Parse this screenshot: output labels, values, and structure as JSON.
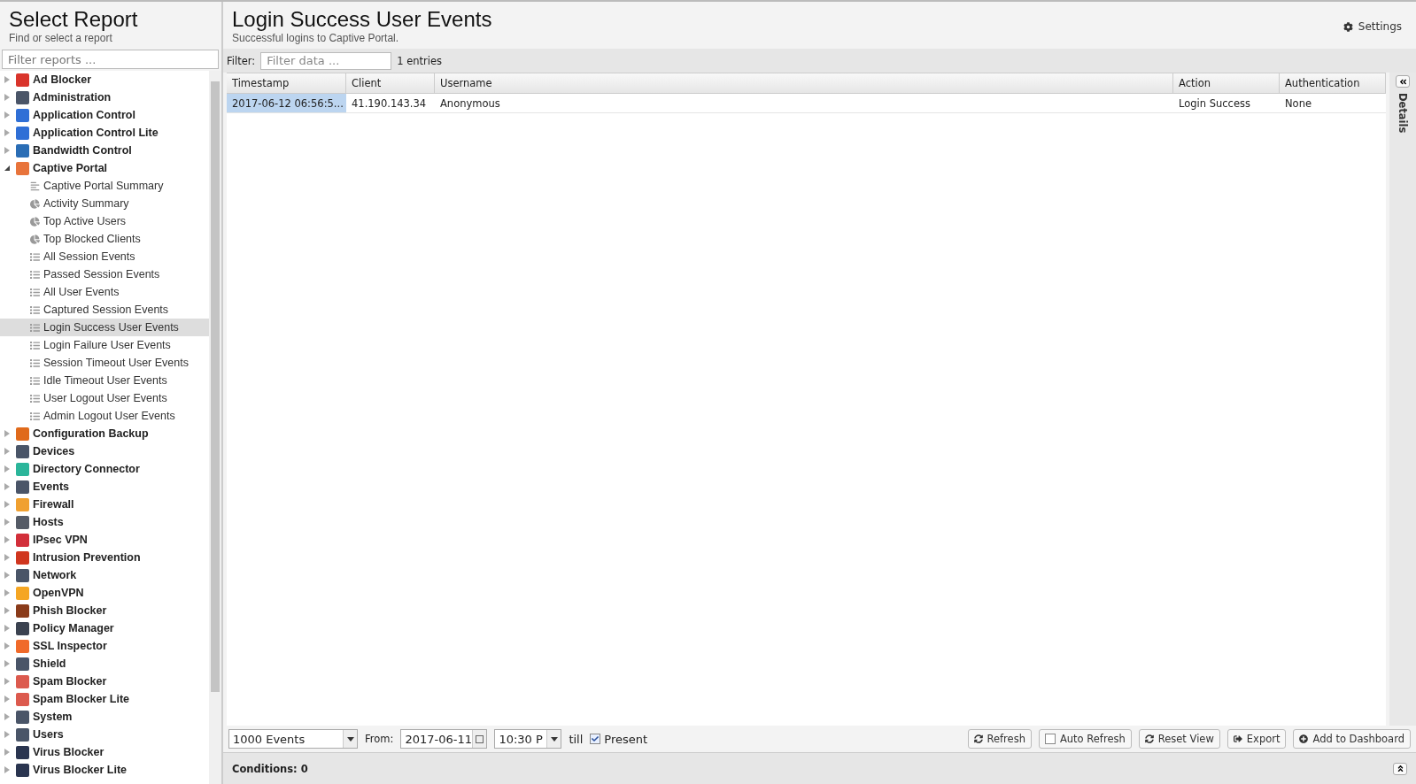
{
  "sidebar": {
    "title": "Select Report",
    "subtitle": "Find or select a report",
    "filter_placeholder": "Filter reports ...",
    "tree": [
      {
        "label": "Ad Blocker",
        "color": "#d9342b",
        "expanded": false,
        "selected": false
      },
      {
        "label": "Administration",
        "color": "#4a5568",
        "expanded": false,
        "selected": false
      },
      {
        "label": "Application Control",
        "color": "#2f6fd6",
        "expanded": false,
        "selected": false
      },
      {
        "label": "Application Control Lite",
        "color": "#2f6fd6",
        "expanded": false,
        "selected": false
      },
      {
        "label": "Bandwidth Control",
        "color": "#2a6db5",
        "expanded": false,
        "selected": false
      },
      {
        "label": "Captive Portal",
        "color": "#e8743b",
        "expanded": true,
        "selected": false,
        "children": [
          {
            "label": "Captive Portal Summary",
            "kind": "text",
            "selected": false
          },
          {
            "label": "Activity Summary",
            "kind": "pie",
            "selected": false
          },
          {
            "label": "Top Active Users",
            "kind": "pie",
            "selected": false
          },
          {
            "label": "Top Blocked Clients",
            "kind": "pie",
            "selected": false
          },
          {
            "label": "All Session Events",
            "kind": "list",
            "selected": false
          },
          {
            "label": "Passed Session Events",
            "kind": "list",
            "selected": false
          },
          {
            "label": "All User Events",
            "kind": "list",
            "selected": false
          },
          {
            "label": "Captured Session Events",
            "kind": "list",
            "selected": false
          },
          {
            "label": "Login Success User Events",
            "kind": "list",
            "selected": true
          },
          {
            "label": "Login Failure User Events",
            "kind": "list",
            "selected": false
          },
          {
            "label": "Session Timeout User Events",
            "kind": "list",
            "selected": false
          },
          {
            "label": "Idle Timeout User Events",
            "kind": "list",
            "selected": false
          },
          {
            "label": "User Logout User Events",
            "kind": "list",
            "selected": false
          },
          {
            "label": "Admin Logout User Events",
            "kind": "list",
            "selected": false
          }
        ]
      },
      {
        "label": "Configuration Backup",
        "color": "#e06a1b",
        "expanded": false,
        "selected": false
      },
      {
        "label": "Devices",
        "color": "#4a5568",
        "expanded": false,
        "selected": false
      },
      {
        "label": "Directory Connector",
        "color": "#2bb59a",
        "expanded": false,
        "selected": false
      },
      {
        "label": "Events",
        "color": "#4a5568",
        "expanded": false,
        "selected": false
      },
      {
        "label": "Firewall",
        "color": "#f0a030",
        "expanded": false,
        "selected": false
      },
      {
        "label": "Hosts",
        "color": "#555b66",
        "expanded": false,
        "selected": false
      },
      {
        "label": "IPsec VPN",
        "color": "#d22f3a",
        "expanded": false,
        "selected": false
      },
      {
        "label": "Intrusion Prevention",
        "color": "#d0361f",
        "expanded": false,
        "selected": false
      },
      {
        "label": "Network",
        "color": "#4a5568",
        "expanded": false,
        "selected": false
      },
      {
        "label": "OpenVPN",
        "color": "#f5a623",
        "expanded": false,
        "selected": false
      },
      {
        "label": "Phish Blocker",
        "color": "#8a3b1a",
        "expanded": false,
        "selected": false
      },
      {
        "label": "Policy Manager",
        "color": "#3b4250",
        "expanded": false,
        "selected": false
      },
      {
        "label": "SSL Inspector",
        "color": "#f06a2a",
        "expanded": false,
        "selected": false
      },
      {
        "label": "Shield",
        "color": "#4a5568",
        "expanded": false,
        "selected": false
      },
      {
        "label": "Spam Blocker",
        "color": "#dc5a4e",
        "expanded": false,
        "selected": false
      },
      {
        "label": "Spam Blocker Lite",
        "color": "#dc5a4e",
        "expanded": false,
        "selected": false
      },
      {
        "label": "System",
        "color": "#4a5568",
        "expanded": false,
        "selected": false
      },
      {
        "label": "Users",
        "color": "#4a5568",
        "expanded": false,
        "selected": false
      },
      {
        "label": "Virus Blocker",
        "color": "#2a3550",
        "expanded": false,
        "selected": false
      },
      {
        "label": "Virus Blocker Lite",
        "color": "#2a3550",
        "expanded": false,
        "selected": false
      }
    ]
  },
  "report": {
    "title": "Login Success User Events",
    "subtitle": "Successful logins to Captive Portal.",
    "settings": "Settings"
  },
  "filter": {
    "label": "Filter:",
    "placeholder": "Filter data ...",
    "count": "1 entries"
  },
  "table": {
    "columns": [
      "Timestamp",
      "Client",
      "Username",
      "Action",
      "Authentication"
    ],
    "rows": [
      {
        "selected": true,
        "cells": [
          "2017-06-12 06:56:5...",
          "41.190.143.34",
          "Anonymous",
          "Login Success",
          "None"
        ]
      }
    ]
  },
  "details_tab": "Details",
  "toolbar": {
    "events": "1000 Events",
    "from_label": "From:",
    "date": "2017-06-11",
    "time": "10:30 P",
    "till": "till",
    "present": {
      "label": "Present",
      "checked": true
    },
    "auto_refresh_checked": false,
    "buttons": [
      {
        "kind": "refresh",
        "label": "Refresh"
      },
      {
        "kind": "checkbox",
        "label": "Auto Refresh"
      },
      {
        "kind": "reset",
        "label": "Reset View"
      },
      {
        "kind": "export",
        "label": "Export"
      },
      {
        "kind": "add",
        "label": "Add to Dashboard"
      }
    ]
  },
  "conditions": "Conditions: 0"
}
